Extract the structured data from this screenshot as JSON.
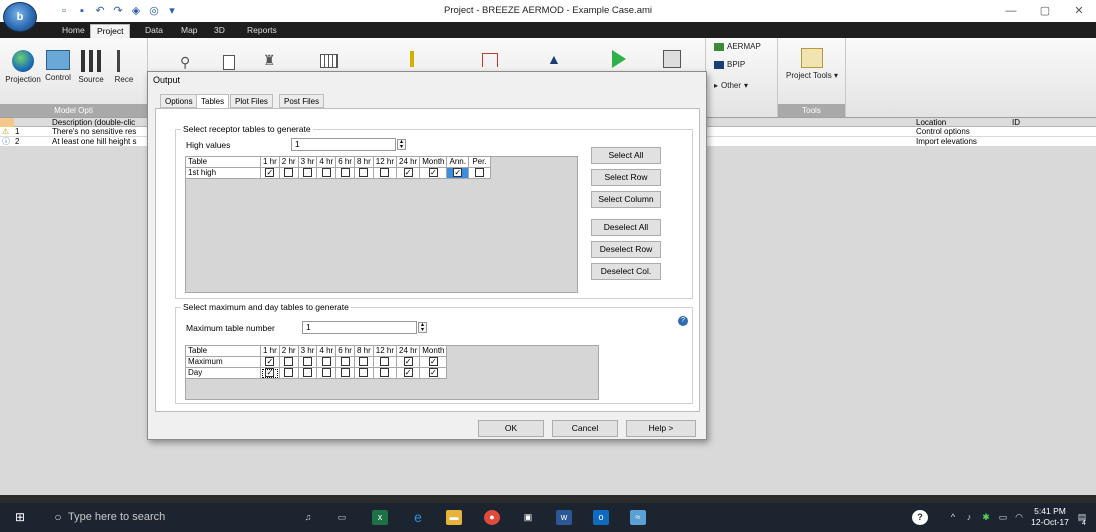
{
  "window": {
    "title": "Project - BREEZE AERMOD - Example Case.ami",
    "minimize": "—",
    "maximize": "▢",
    "close": "✕"
  },
  "app_orb": "b",
  "ribbon_tabs": [
    "Home",
    "Project",
    "Data",
    "Map",
    "3D",
    "Reports"
  ],
  "ribbon": {
    "buttons": [
      "Projection",
      "Control",
      "Source",
      "Rece"
    ],
    "group_model": "Model Opti",
    "aermap": "AERMAP",
    "bpip": "BPIP",
    "other": "Other",
    "project_tools": "Project Tools",
    "group_tools": "Tools"
  },
  "messages": {
    "columns": {
      "description": "Description (double-clic",
      "location": "Location",
      "id": "ID"
    },
    "rows": [
      {
        "num": "1",
        "icon": "warning-icon",
        "description": "There's no sensitive res",
        "location": "Control options"
      },
      {
        "num": "2",
        "icon": "info-icon",
        "description": "At least one hill height s",
        "location": "Import elevations"
      }
    ]
  },
  "dialog": {
    "title": "Output",
    "tabs": [
      "Options",
      "Tables",
      "Plot Files",
      "Post Files"
    ],
    "active_tab": "Tables",
    "receptor_group": {
      "title": "Select receptor tables to generate",
      "high_values_label": "High values",
      "high_values": "1",
      "columns": [
        "Table",
        "1 hr",
        "2 hr",
        "3 hr",
        "4 hr",
        "6 hr",
        "8 hr",
        "12 hr",
        "24 hr",
        "Month",
        "Ann.",
        "Per."
      ],
      "rows": [
        {
          "name": "1st high",
          "checks": [
            true,
            false,
            false,
            false,
            false,
            false,
            false,
            true,
            true,
            true,
            false
          ]
        }
      ]
    },
    "side_buttons": [
      "Select All",
      "Select Row",
      "Select Column",
      "Deselect All",
      "Deselect Row",
      "Deselect Col."
    ],
    "max_group": {
      "title": "Select maximum and day tables to generate",
      "max_table_label": "Maximum table number",
      "max_table_value": "1",
      "columns": [
        "Table",
        "1 hr",
        "2 hr",
        "3 hr",
        "4 hr",
        "6 hr",
        "8 hr",
        "12 hr",
        "24 hr",
        "Month"
      ],
      "rows": [
        {
          "name": "Maximum",
          "checks": [
            true,
            false,
            false,
            false,
            false,
            false,
            false,
            true,
            true
          ]
        },
        {
          "name": "Day",
          "checks": [
            true,
            false,
            false,
            false,
            false,
            false,
            false,
            true,
            true
          ]
        }
      ]
    },
    "ok": "OK",
    "cancel": "Cancel",
    "help": "Help >"
  },
  "taskbar": {
    "search_placeholder": "Type here to search",
    "time": "5:41 PM",
    "date": "12-Oct-17",
    "notification_count": "4"
  },
  "colors": {
    "accent": "#2e6db4",
    "taskbar": "#1c2430",
    "selected_cell": "#3b8de0"
  }
}
